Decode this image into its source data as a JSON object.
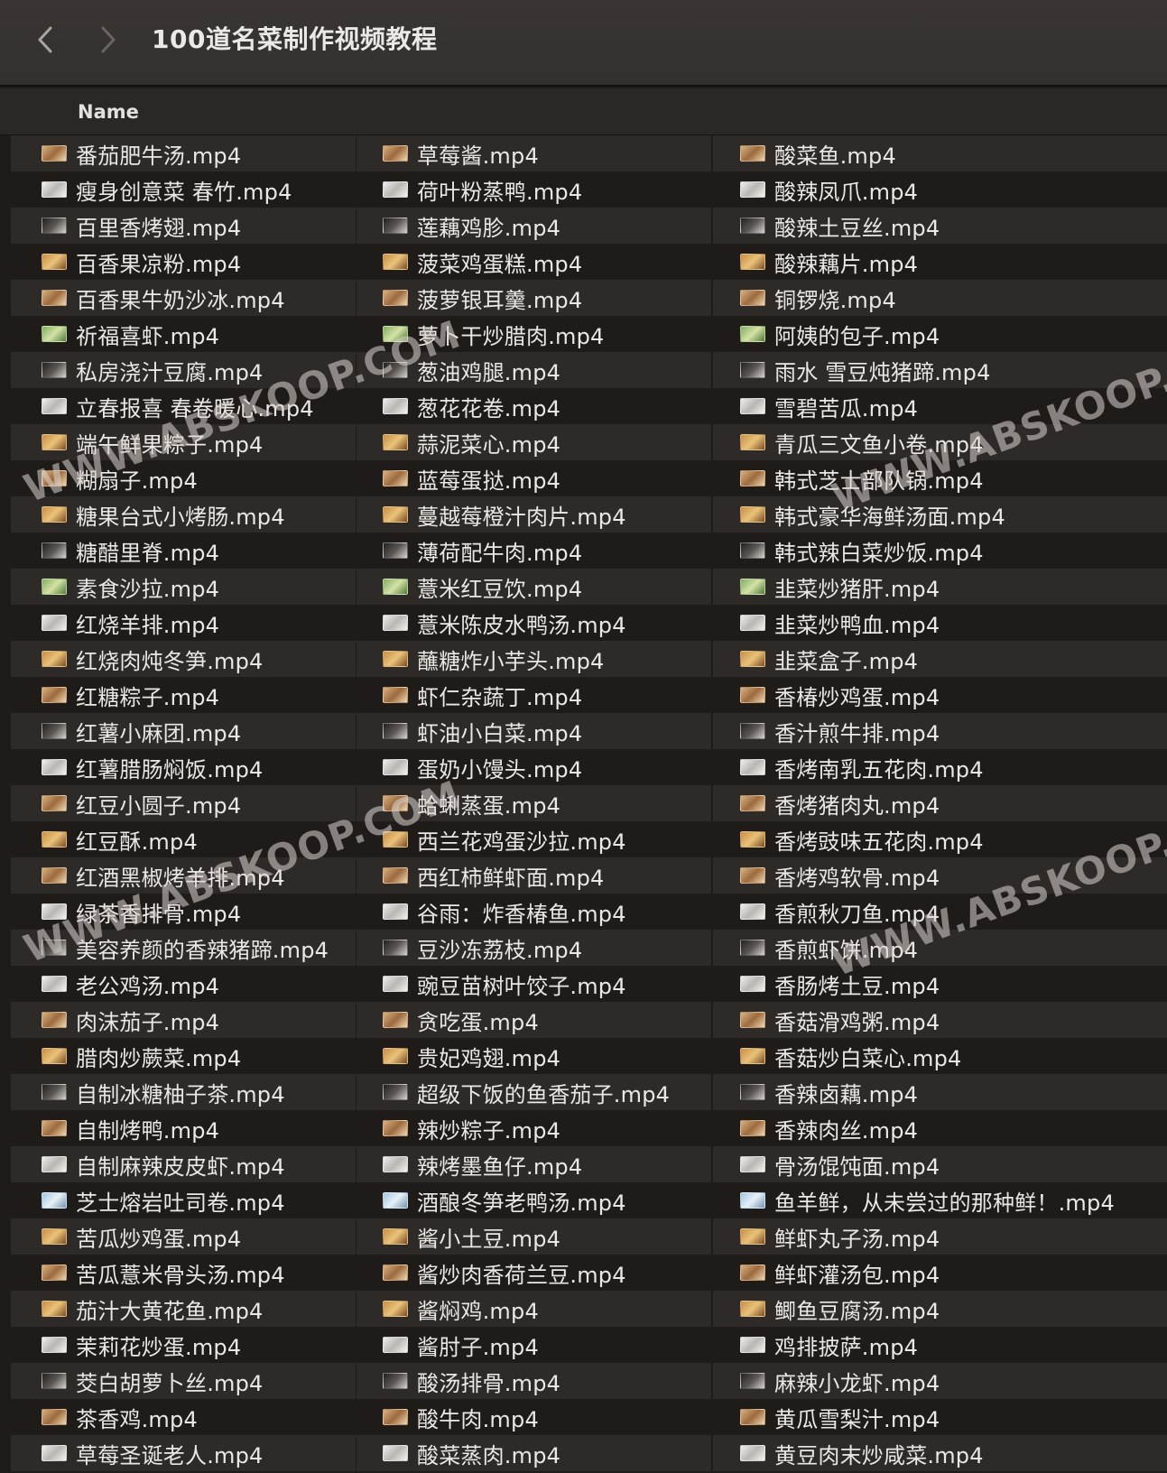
{
  "window": {
    "title": "100道名菜制作视频教程"
  },
  "list_header": {
    "name_label": "Name"
  },
  "watermark": {
    "text": "WWW.ABSKOOP.COM"
  },
  "files": {
    "col1": [
      "番茄肥牛汤.mp4",
      "瘦身创意菜 春竹.mp4",
      "百里香烤翅.mp4",
      "百香果凉粉.mp4",
      "百香果牛奶沙冰.mp4",
      "祈福喜虾.mp4",
      "私房浇汁豆腐.mp4",
      "立春报喜 春卷暖心.mp4",
      "端午鲜果粽子.mp4",
      "糊扇子.mp4",
      "糖果台式小烤肠.mp4",
      "糖醋里脊.mp4",
      "素食沙拉.mp4",
      "红烧羊排.mp4",
      "红烧肉炖冬笋.mp4",
      "红糖粽子.mp4",
      "红薯小麻团.mp4",
      "红薯腊肠焖饭.mp4",
      "红豆小圆子.mp4",
      "红豆酥.mp4",
      "红酒黑椒烤羊排.mp4",
      "绿茶香排骨.mp4",
      "美容养颜的香辣猪蹄.mp4",
      "老公鸡汤.mp4",
      "肉沫茄子.mp4",
      "腊肉炒蕨菜.mp4",
      "自制冰糖柚子茶.mp4",
      "自制烤鸭.mp4",
      "自制麻辣皮皮虾.mp4",
      "芝士熔岩吐司卷.mp4",
      "苦瓜炒鸡蛋.mp4",
      "苦瓜薏米骨头汤.mp4",
      "茄汁大黄花鱼.mp4",
      "茉莉花炒蛋.mp4",
      "茭白胡萝卜丝.mp4",
      "茶香鸡.mp4",
      "草莓圣诞老人.mp4"
    ],
    "col2": [
      "草莓酱.mp4",
      "荷叶粉蒸鸭.mp4",
      "莲藕鸡胗.mp4",
      "菠菜鸡蛋糕.mp4",
      "菠萝银耳羹.mp4",
      "萝卜干炒腊肉.mp4",
      "葱油鸡腿.mp4",
      "葱花花卷.mp4",
      "蒜泥菜心.mp4",
      "蓝莓蛋挞.mp4",
      "蔓越莓橙汁肉片.mp4",
      "薄荷配牛肉.mp4",
      "薏米红豆饮.mp4",
      "薏米陈皮水鸭汤.mp4",
      "蘸糖炸小芋头.mp4",
      "虾仁杂蔬丁.mp4",
      "虾油小白菜.mp4",
      "蛋奶小馒头.mp4",
      "蛤蜊蒸蛋.mp4",
      "西兰花鸡蛋沙拉.mp4",
      "西红柿鲜虾面.mp4",
      "谷雨：炸香椿鱼.mp4",
      "豆沙冻荔枝.mp4",
      "豌豆苗树叶饺子.mp4",
      "贪吃蛋.mp4",
      "贵妃鸡翅.mp4",
      "超级下饭的鱼香茄子.mp4",
      "辣炒粽子.mp4",
      "辣烤墨鱼仔.mp4",
      "酒酿冬笋老鸭汤.mp4",
      "酱小土豆.mp4",
      "酱炒肉香荷兰豆.mp4",
      "酱焖鸡.mp4",
      "酱肘子.mp4",
      "酸汤排骨.mp4",
      "酸牛肉.mp4",
      "酸菜蒸肉.mp4"
    ],
    "col3": [
      "酸菜鱼.mp4",
      "酸辣凤爪.mp4",
      "酸辣土豆丝.mp4",
      "酸辣藕片.mp4",
      "铜锣烧.mp4",
      "阿姨的包子.mp4",
      "雨水 雪豆炖猪蹄.mp4",
      "雪碧苦瓜.mp4",
      "青瓜三文鱼小卷.mp4",
      "韩式芝士部队锅.mp4",
      "韩式豪华海鲜汤面.mp4",
      "韩式辣白菜炒饭.mp4",
      "韭菜炒猪肝.mp4",
      "韭菜炒鸭血.mp4",
      "韭菜盒子.mp4",
      "香椿炒鸡蛋.mp4",
      "香汁煎牛排.mp4",
      "香烤南乳五花肉.mp4",
      "香烤猪肉丸.mp4",
      "香烤豉味五花肉.mp4",
      "香烤鸡软骨.mp4",
      "香煎秋刀鱼.mp4",
      "香煎虾饼.mp4",
      "香肠烤土豆.mp4",
      "香菇滑鸡粥.mp4",
      "香菇炒白菜心.mp4",
      "香辣卤藕.mp4",
      "香辣肉丝.mp4",
      "骨汤馄饨面.mp4",
      "鱼羊鲜，从未尝过的那种鲜！.mp4",
      "鲜虾丸子汤.mp4",
      "鲜虾灌汤包.mp4",
      "鲫鱼豆腐汤.mp4",
      "鸡排披萨.mp4",
      "麻辣小龙虾.mp4",
      "黄瓜雪梨汁.mp4",
      "黄豆肉末炒咸菜.mp4"
    ]
  },
  "thumb_styles": [
    "t1",
    "t2",
    "t3",
    "t4",
    "t1",
    "t7",
    "t3",
    "t2",
    "t4",
    "t1",
    "t4",
    "t3",
    "t7",
    "t2",
    "t4",
    "t1",
    "t3",
    "t2",
    "t1",
    "t4",
    "t1",
    "t2",
    "t3",
    "t2",
    "t1",
    "t4",
    "t3",
    "t1",
    "t2",
    "t5",
    "t4",
    "t1",
    "t4",
    "t2",
    "t3",
    "t1",
    "t2"
  ]
}
